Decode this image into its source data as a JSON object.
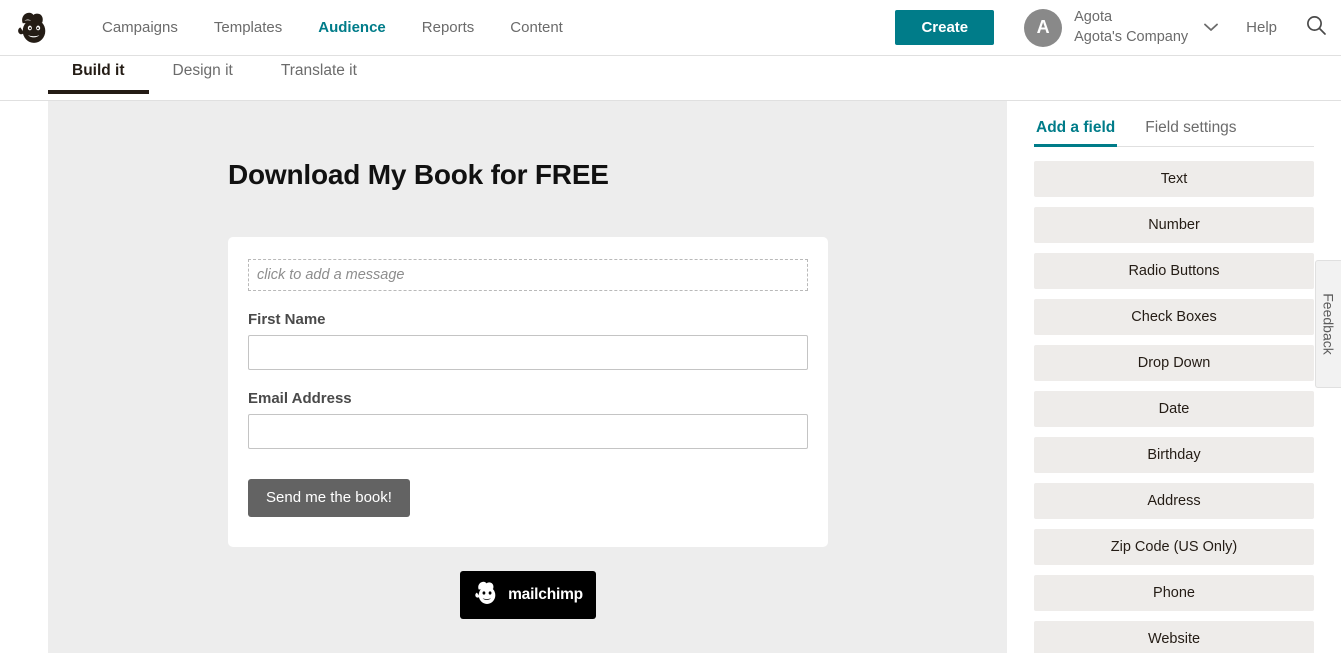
{
  "topbar": {
    "logo_icon": "mailchimp-freddie-logo",
    "nav": [
      {
        "label": "Campaigns",
        "active": false
      },
      {
        "label": "Templates",
        "active": false
      },
      {
        "label": "Audience",
        "active": true
      },
      {
        "label": "Reports",
        "active": false
      },
      {
        "label": "Content",
        "active": false
      }
    ],
    "create_label": "Create",
    "account": {
      "avatar_initial": "A",
      "user_name": "Agota",
      "company_name": "Agota's Company",
      "chevron_icon": "chevron-down-icon"
    },
    "help_label": "Help",
    "search_icon": "search-icon",
    "accent_color": "#007c89"
  },
  "subtabs": [
    {
      "label": "Build it",
      "active": true
    },
    {
      "label": "Design it",
      "active": false
    },
    {
      "label": "Translate it",
      "active": false
    }
  ],
  "preview": {
    "form_title": "Download My Book for FREE",
    "message_placeholder": "click to add a message",
    "fields": [
      {
        "label": "First Name",
        "value": "",
        "type": "text"
      },
      {
        "label": "Email Address",
        "value": "",
        "type": "email"
      }
    ],
    "submit_label": "Send me the book!",
    "badge": {
      "icon": "mailchimp-freddie-logo",
      "wordmark": "mailchimp"
    },
    "background_color": "#ededed",
    "card_color": "#ffffff",
    "submit_color": "#636363"
  },
  "sidebar": {
    "tabs": [
      {
        "label": "Add a field",
        "active": true
      },
      {
        "label": "Field settings",
        "active": false
      }
    ],
    "field_types": [
      {
        "label": "Text"
      },
      {
        "label": "Number"
      },
      {
        "label": "Radio Buttons"
      },
      {
        "label": "Check Boxes"
      },
      {
        "label": "Drop Down"
      },
      {
        "label": "Date"
      },
      {
        "label": "Birthday"
      },
      {
        "label": "Address"
      },
      {
        "label": "Zip Code (US Only)"
      },
      {
        "label": "Phone"
      },
      {
        "label": "Website"
      }
    ]
  },
  "feedback_tab": {
    "label": "Feedback"
  }
}
